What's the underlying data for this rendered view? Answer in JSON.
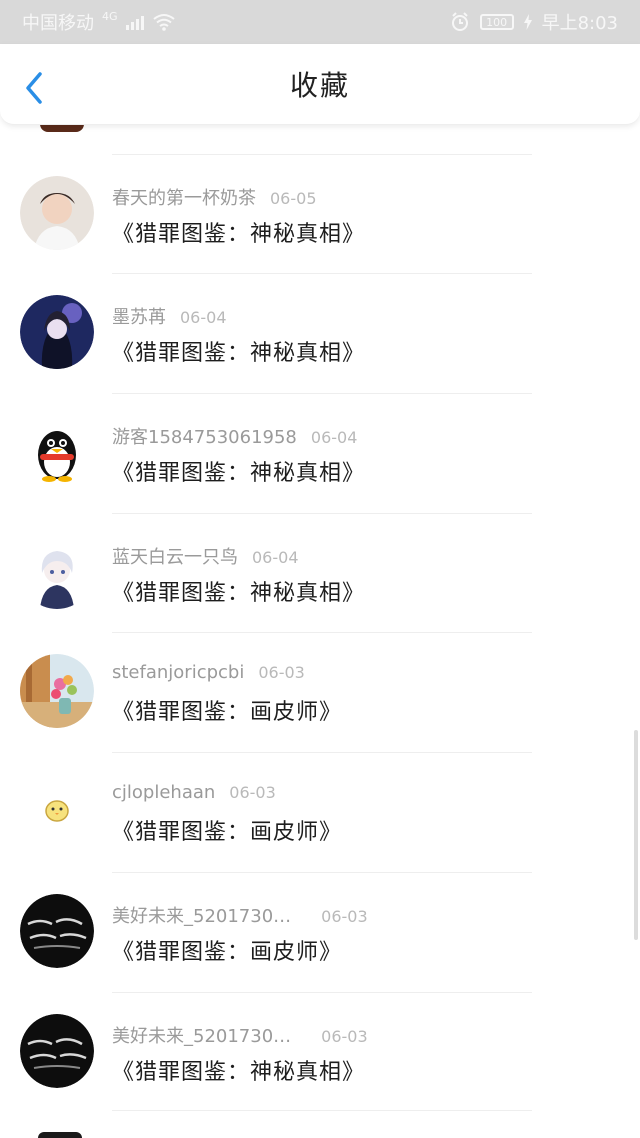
{
  "status_bar": {
    "carrier": "中国移动",
    "network": "4G",
    "battery": "100",
    "time": "早上8:03"
  },
  "header": {
    "title": "收藏"
  },
  "favorites": [
    {
      "user": "春天的第一杯奶茶",
      "date": "06-05",
      "book": "《猎罪图鉴：神秘真相》",
      "avatar": "young-man-photo"
    },
    {
      "user": "墨苏苒",
      "date": "06-04",
      "book": "《猎罪图鉴：神秘真相》",
      "avatar": "anime-girl-dark"
    },
    {
      "user": "游客1584753061958",
      "date": "06-04",
      "book": "《猎罪图鉴：神秘真相》",
      "avatar": "qq-penguin"
    },
    {
      "user": "蓝天白云一只鸟",
      "date": "06-04",
      "book": "《猎罪图鉴：神秘真相》",
      "avatar": "anime-boy-white-hair"
    },
    {
      "user": "stefanjoricpcbi",
      "date": "06-03",
      "book": "《猎罪图鉴：画皮师》",
      "avatar": "flower-vase"
    },
    {
      "user": "cjloplehaan",
      "date": "06-03",
      "book": "《猎罪图鉴：画皮师》",
      "avatar": "yellow-chick"
    },
    {
      "user": "美好未来_5201730…",
      "date": "06-03",
      "book": "《猎罪图鉴：画皮师》",
      "avatar": "black-calligraphy"
    },
    {
      "user": "美好未来_5201730…",
      "date": "06-03",
      "book": "《猎罪图鉴：神秘真相》",
      "avatar": "black-calligraphy"
    }
  ],
  "colors": {
    "accent": "#2a8ee6",
    "status_bar_bg": "#d9d9d9"
  }
}
